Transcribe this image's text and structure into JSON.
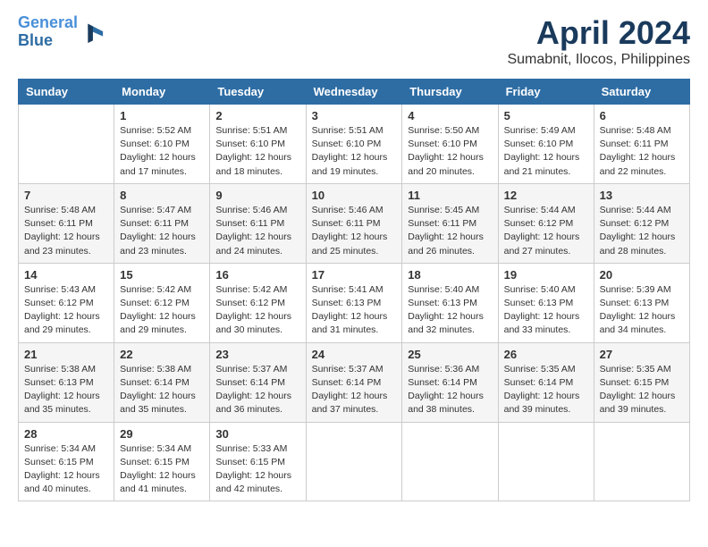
{
  "logo": {
    "line1": "General",
    "line2": "Blue"
  },
  "title": "April 2024",
  "location": "Sumabnit, Ilocos, Philippines",
  "days_header": [
    "Sunday",
    "Monday",
    "Tuesday",
    "Wednesday",
    "Thursday",
    "Friday",
    "Saturday"
  ],
  "weeks": [
    [
      {
        "day": "",
        "info": ""
      },
      {
        "day": "1",
        "info": "Sunrise: 5:52 AM\nSunset: 6:10 PM\nDaylight: 12 hours\nand 17 minutes."
      },
      {
        "day": "2",
        "info": "Sunrise: 5:51 AM\nSunset: 6:10 PM\nDaylight: 12 hours\nand 18 minutes."
      },
      {
        "day": "3",
        "info": "Sunrise: 5:51 AM\nSunset: 6:10 PM\nDaylight: 12 hours\nand 19 minutes."
      },
      {
        "day": "4",
        "info": "Sunrise: 5:50 AM\nSunset: 6:10 PM\nDaylight: 12 hours\nand 20 minutes."
      },
      {
        "day": "5",
        "info": "Sunrise: 5:49 AM\nSunset: 6:10 PM\nDaylight: 12 hours\nand 21 minutes."
      },
      {
        "day": "6",
        "info": "Sunrise: 5:48 AM\nSunset: 6:11 PM\nDaylight: 12 hours\nand 22 minutes."
      }
    ],
    [
      {
        "day": "7",
        "info": "Sunrise: 5:48 AM\nSunset: 6:11 PM\nDaylight: 12 hours\nand 23 minutes."
      },
      {
        "day": "8",
        "info": "Sunrise: 5:47 AM\nSunset: 6:11 PM\nDaylight: 12 hours\nand 23 minutes."
      },
      {
        "day": "9",
        "info": "Sunrise: 5:46 AM\nSunset: 6:11 PM\nDaylight: 12 hours\nand 24 minutes."
      },
      {
        "day": "10",
        "info": "Sunrise: 5:46 AM\nSunset: 6:11 PM\nDaylight: 12 hours\nand 25 minutes."
      },
      {
        "day": "11",
        "info": "Sunrise: 5:45 AM\nSunset: 6:11 PM\nDaylight: 12 hours\nand 26 minutes."
      },
      {
        "day": "12",
        "info": "Sunrise: 5:44 AM\nSunset: 6:12 PM\nDaylight: 12 hours\nand 27 minutes."
      },
      {
        "day": "13",
        "info": "Sunrise: 5:44 AM\nSunset: 6:12 PM\nDaylight: 12 hours\nand 28 minutes."
      }
    ],
    [
      {
        "day": "14",
        "info": "Sunrise: 5:43 AM\nSunset: 6:12 PM\nDaylight: 12 hours\nand 29 minutes."
      },
      {
        "day": "15",
        "info": "Sunrise: 5:42 AM\nSunset: 6:12 PM\nDaylight: 12 hours\nand 29 minutes."
      },
      {
        "day": "16",
        "info": "Sunrise: 5:42 AM\nSunset: 6:12 PM\nDaylight: 12 hours\nand 30 minutes."
      },
      {
        "day": "17",
        "info": "Sunrise: 5:41 AM\nSunset: 6:13 PM\nDaylight: 12 hours\nand 31 minutes."
      },
      {
        "day": "18",
        "info": "Sunrise: 5:40 AM\nSunset: 6:13 PM\nDaylight: 12 hours\nand 32 minutes."
      },
      {
        "day": "19",
        "info": "Sunrise: 5:40 AM\nSunset: 6:13 PM\nDaylight: 12 hours\nand 33 minutes."
      },
      {
        "day": "20",
        "info": "Sunrise: 5:39 AM\nSunset: 6:13 PM\nDaylight: 12 hours\nand 34 minutes."
      }
    ],
    [
      {
        "day": "21",
        "info": "Sunrise: 5:38 AM\nSunset: 6:13 PM\nDaylight: 12 hours\nand 35 minutes."
      },
      {
        "day": "22",
        "info": "Sunrise: 5:38 AM\nSunset: 6:14 PM\nDaylight: 12 hours\nand 35 minutes."
      },
      {
        "day": "23",
        "info": "Sunrise: 5:37 AM\nSunset: 6:14 PM\nDaylight: 12 hours\nand 36 minutes."
      },
      {
        "day": "24",
        "info": "Sunrise: 5:37 AM\nSunset: 6:14 PM\nDaylight: 12 hours\nand 37 minutes."
      },
      {
        "day": "25",
        "info": "Sunrise: 5:36 AM\nSunset: 6:14 PM\nDaylight: 12 hours\nand 38 minutes."
      },
      {
        "day": "26",
        "info": "Sunrise: 5:35 AM\nSunset: 6:14 PM\nDaylight: 12 hours\nand 39 minutes."
      },
      {
        "day": "27",
        "info": "Sunrise: 5:35 AM\nSunset: 6:15 PM\nDaylight: 12 hours\nand 39 minutes."
      }
    ],
    [
      {
        "day": "28",
        "info": "Sunrise: 5:34 AM\nSunset: 6:15 PM\nDaylight: 12 hours\nand 40 minutes."
      },
      {
        "day": "29",
        "info": "Sunrise: 5:34 AM\nSunset: 6:15 PM\nDaylight: 12 hours\nand 41 minutes."
      },
      {
        "day": "30",
        "info": "Sunrise: 5:33 AM\nSunset: 6:15 PM\nDaylight: 12 hours\nand 42 minutes."
      },
      {
        "day": "",
        "info": ""
      },
      {
        "day": "",
        "info": ""
      },
      {
        "day": "",
        "info": ""
      },
      {
        "day": "",
        "info": ""
      }
    ]
  ]
}
